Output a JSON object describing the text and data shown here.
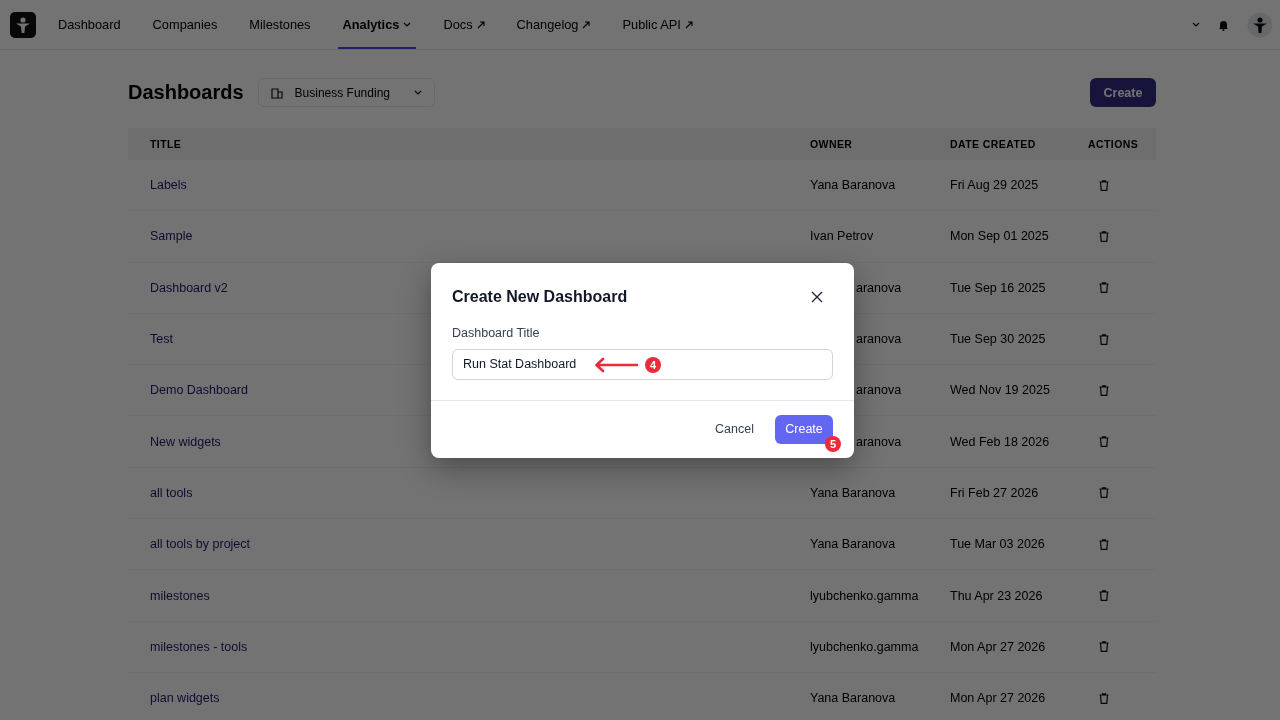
{
  "nav": {
    "items": [
      {
        "label": "Dashboard",
        "kind": "plain",
        "selected": false
      },
      {
        "label": "Companies",
        "kind": "plain",
        "selected": false
      },
      {
        "label": "Milestones",
        "kind": "plain",
        "selected": false
      },
      {
        "label": "Analytics",
        "kind": "dropdown",
        "selected": true
      },
      {
        "label": "Docs",
        "kind": "external",
        "selected": false
      },
      {
        "label": "Changelog",
        "kind": "external",
        "selected": false
      },
      {
        "label": "Public API",
        "kind": "external",
        "selected": false
      }
    ]
  },
  "header": {
    "title": "Dashboards",
    "workspace": "Business Funding",
    "create_button": "Create"
  },
  "table": {
    "columns": [
      "TITLE",
      "OWNER",
      "DATE CREATED",
      "ACTIONS"
    ],
    "rows": [
      {
        "title": "Labels",
        "owner": "Yana Baranova",
        "date": "Fri Aug 29 2025"
      },
      {
        "title": "Sample",
        "owner": "Ivan Petrov",
        "date": "Mon Sep 01 2025"
      },
      {
        "title": "Dashboard v2",
        "owner_partial": "aranova",
        "date": "Tue Sep 16 2025"
      },
      {
        "title": "Test",
        "owner_partial": "aranova",
        "date": "Tue Sep 30 2025"
      },
      {
        "title": "Demo Dashboard",
        "owner_partial": "aranova",
        "date": "Wed Nov 19 2025"
      },
      {
        "title": "New widgets",
        "owner_partial": "aranova",
        "date": "Wed Feb 18 2026"
      },
      {
        "title": "all tools",
        "owner": "Yana Baranova",
        "date": "Fri Feb 27 2026"
      },
      {
        "title": "all tools by project",
        "owner": "Yana Baranova",
        "date": "Tue Mar 03 2026"
      },
      {
        "title": "milestones",
        "owner": "lyubchenko.gamma",
        "date": "Thu Apr 23 2026"
      },
      {
        "title": "milestones - tools",
        "owner": "lyubchenko.gamma",
        "date": "Mon Apr 27 2026"
      },
      {
        "title": "plan widgets",
        "owner": "Yana Baranova",
        "date": "Mon Apr 27 2026"
      }
    ]
  },
  "dialog": {
    "title": "Create New Dashboard",
    "field": {
      "label": "Dashboard Title",
      "value": "Run Stat Dashboard",
      "step": "4"
    },
    "buttons": [
      {
        "label": "Cancel",
        "kind": "secondary"
      },
      {
        "label": "Create",
        "kind": "primary",
        "step": "5"
      }
    ]
  }
}
